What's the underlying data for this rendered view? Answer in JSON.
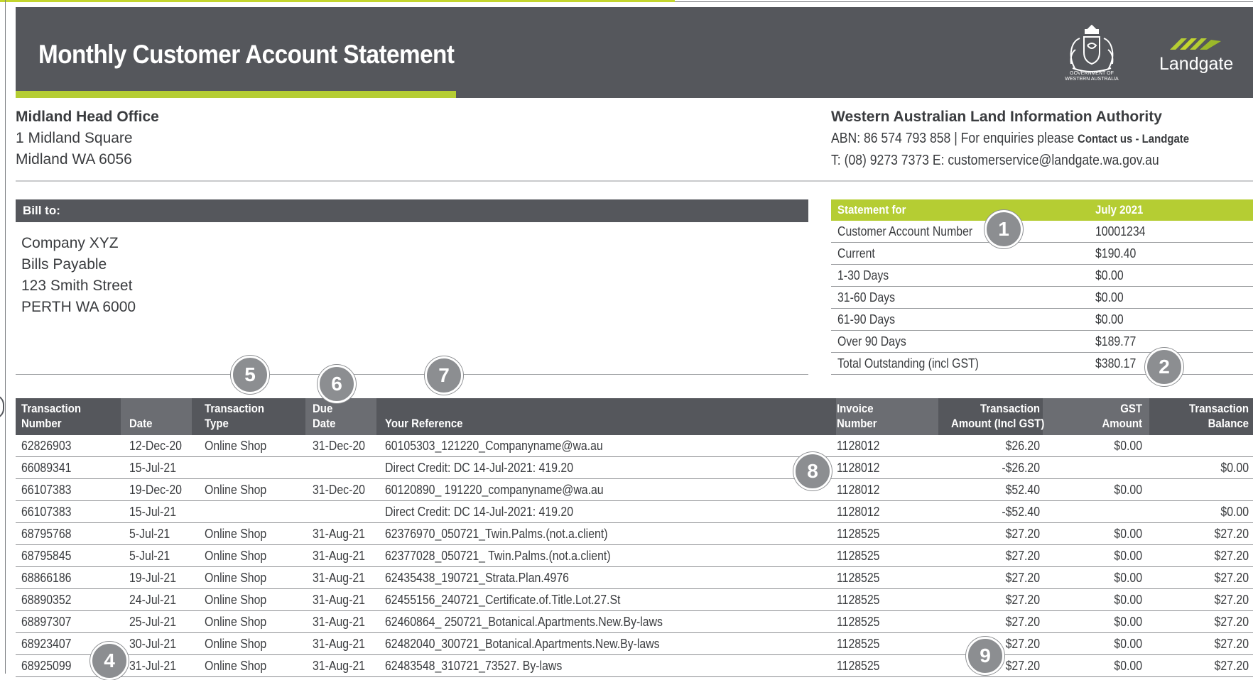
{
  "header": {
    "title": "Monthly Customer Account Statement",
    "crest_caption_line1": "GOVERNMENT OF",
    "crest_caption_line2": "WESTERN AUSTRALIA",
    "brand": "Landgate",
    "colors": {
      "header_bg": "#55575c",
      "accent": "#b5cd33"
    },
    "icons": [
      "government-crest-icon",
      "landgate-logo-icon"
    ]
  },
  "office": {
    "name": "Midland Head Office",
    "line1": "1 Midland Square",
    "line2": "Midland WA 6056"
  },
  "authority": {
    "name": "Western Australian Land Information Authority",
    "abn_text": "ABN: 86 574 793 858  |  For enquiries please",
    "contact_link": "Contact us - Landgate",
    "contact_line": "T: (08) 9273 7373 E: customerservice@landgate.wa.gov.au"
  },
  "bill_to": {
    "heading": "Bill to:",
    "lines": [
      "Company XYZ",
      "Bills Payable",
      "123 Smith Street",
      "PERTH WA 6000"
    ]
  },
  "statement": {
    "heading_label": "Statement for",
    "heading_value": "July 2021",
    "rows": [
      {
        "label": "Customer Account Number",
        "value": "10001234"
      },
      {
        "label": "Current",
        "value": "$190.40"
      },
      {
        "label": "1-30 Days",
        "value": "$0.00"
      },
      {
        "label": "31-60 Days",
        "value": "$0.00"
      },
      {
        "label": "61-90 Days",
        "value": "$0.00"
      },
      {
        "label": "Over 90 Days",
        "value": "$189.77"
      },
      {
        "label": "Total Outstanding (incl GST)",
        "value": "$380.17"
      }
    ]
  },
  "transactions": {
    "headers": {
      "number_1": "Transaction",
      "number_2": "Number",
      "date": "Date",
      "type_1": "Transaction",
      "type_2": "Type",
      "due_1": "Due",
      "due_2": "Date",
      "reference": "Your Reference",
      "invoice_1": "Invoice",
      "invoice_2": "Number",
      "amount_1": "Transaction",
      "amount_2": "Amount (Incl GST)",
      "gst_1": "GST",
      "gst_2": "Amount",
      "balance_1": "Transaction",
      "balance_2": "Balance"
    },
    "rows": [
      {
        "number": "62826903",
        "date": "12-Dec-20",
        "type": "Online Shop",
        "due": "31-Dec-20",
        "reference": "60105303_121220_Companyname@wa.au",
        "invoice": "1128012",
        "amount": "$26.20",
        "gst": "$0.00",
        "balance": ""
      },
      {
        "number": "66089341",
        "date": "15-Jul-21",
        "type": "",
        "due": "",
        "reference": "Direct Credit: DC 14-Jul-2021:   419.20",
        "invoice": "1128012",
        "amount": "-$26.20",
        "gst": "",
        "balance": "$0.00"
      },
      {
        "number": "66107383",
        "date": "19-Dec-20",
        "type": "Online Shop",
        "due": "31-Dec-20",
        "reference": "60120890_ 191220_companyname@wa.au",
        "invoice": "1128012",
        "amount": "$52.40",
        "gst": "$0.00",
        "balance": ""
      },
      {
        "number": "66107383",
        "date": "15-Jul-21",
        "type": "",
        "due": "",
        "reference": "Direct Credit: DC 14-Jul-2021:   419.20",
        "invoice": "1128012",
        "amount": "-$52.40",
        "gst": "",
        "balance": "$0.00"
      },
      {
        "number": "68795768",
        "date": "5-Jul-21",
        "type": "Online Shop",
        "due": "31-Aug-21",
        "reference": "62376970_050721_Twin.Palms.(not.a.client)",
        "invoice": "1128525",
        "amount": "$27.20",
        "gst": "$0.00",
        "balance": "$27.20"
      },
      {
        "number": "68795845",
        "date": "5-Jul-21",
        "type": "Online Shop",
        "due": "31-Aug-21",
        "reference": "62377028_050721_ Twin.Palms.(not.a.client)",
        "invoice": "1128525",
        "amount": "$27.20",
        "gst": "$0.00",
        "balance": "$27.20"
      },
      {
        "number": "68866186",
        "date": "19-Jul-21",
        "type": "Online Shop",
        "due": "31-Aug-21",
        "reference": "62435438_190721_Strata.Plan.4976",
        "invoice": "1128525",
        "amount": "$27.20",
        "gst": "$0.00",
        "balance": "$27.20"
      },
      {
        "number": "68890352",
        "date": "24-Jul-21",
        "type": "Online Shop",
        "due": "31-Aug-21",
        "reference": "62455156_240721_Certificate.of.Title.Lot.27.St",
        "invoice": "1128525",
        "amount": "$27.20",
        "gst": "$0.00",
        "balance": "$27.20"
      },
      {
        "number": "68897307",
        "date": "25-Jul-21",
        "type": "Online Shop",
        "due": "31-Aug-21",
        "reference": "62460864_ 250721_Botanical.Apartments.New.By-laws",
        "invoice": "1128525",
        "amount": "$27.20",
        "gst": "$0.00",
        "balance": "$27.20"
      },
      {
        "number": "68923407",
        "date": "30-Jul-21",
        "type": "Online Shop",
        "due": "31-Aug-21",
        "reference": "62482040_300721_Botanical.Apartments.New.By-laws",
        "invoice": "1128525",
        "amount": "$27.20",
        "gst": "$0.00",
        "balance": "$27.20"
      },
      {
        "number": "68925099",
        "date": "31-Jul-21",
        "type": "Online Shop",
        "due": "31-Aug-21",
        "reference": "62483548_310721_73527. By-laws",
        "invoice": "1128525",
        "amount": "$27.20",
        "gst": "$0.00",
        "balance": "$27.20"
      }
    ]
  },
  "callouts": [
    "1",
    "2",
    "4",
    "5",
    "6",
    "7",
    "8",
    "9"
  ]
}
